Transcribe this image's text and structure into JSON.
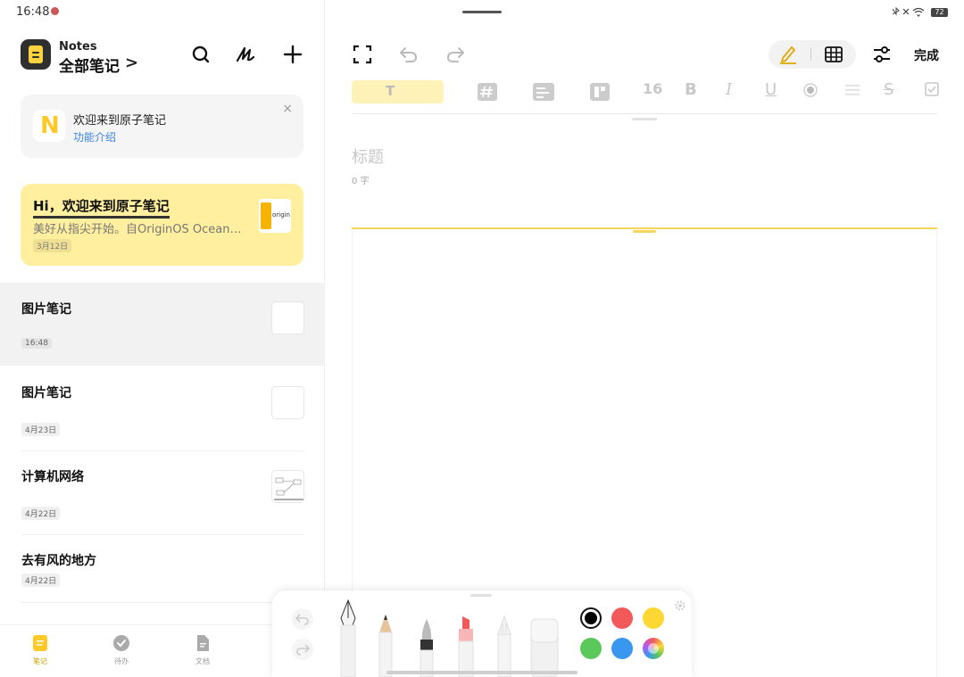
{
  "status": {
    "time": "16:48",
    "battery": "72"
  },
  "header": {
    "app_name": "Notes",
    "folder_title": "全部笔记",
    "folder_chevron": ">"
  },
  "welcome_card": {
    "title": "欢迎来到原子笔记",
    "link": "功能介绍",
    "close": "×",
    "logo_letter": "N"
  },
  "featured_note": {
    "title": "Hi，欢迎来到原子笔记",
    "subtitle": "美好从指尖开始。自OriginOS Ocean…",
    "date": "3月12日",
    "thumb_text": "origin"
  },
  "notes": [
    {
      "title": "图片笔记",
      "date": "16:48",
      "selected": true
    },
    {
      "title": "图片笔记",
      "date": "4月23日"
    },
    {
      "title": "计算机网络",
      "date": "4月22日"
    },
    {
      "title": "去有风的地方",
      "date": "4月22日"
    }
  ],
  "bottom_nav": [
    {
      "label": "笔记",
      "icon": "notes-icon",
      "active": true
    },
    {
      "label": "待办",
      "icon": "todo-check-icon"
    },
    {
      "label": "文档",
      "icon": "document-icon"
    }
  ],
  "editor": {
    "done_label": "完成",
    "font_size": "16",
    "format_text_glyph": "T",
    "bold": "B",
    "italic": "I",
    "underline": "U",
    "strike": "S",
    "title_placeholder": "标题",
    "word_count": "0 字"
  },
  "palette": {
    "tools": [
      "fountain-pen",
      "pencil",
      "brush-pen",
      "highlighter",
      "ballpoint-pen",
      "eraser"
    ],
    "colors": [
      "#000000",
      "#f25a5a",
      "#fdd835",
      "#5ac85a",
      "#3a97f0",
      "rainbow"
    ],
    "selected_color": "#000000"
  },
  "colors": {
    "accent": "#ffd23f",
    "featured_bg": "#ffef9e",
    "link": "#3a84d8"
  }
}
